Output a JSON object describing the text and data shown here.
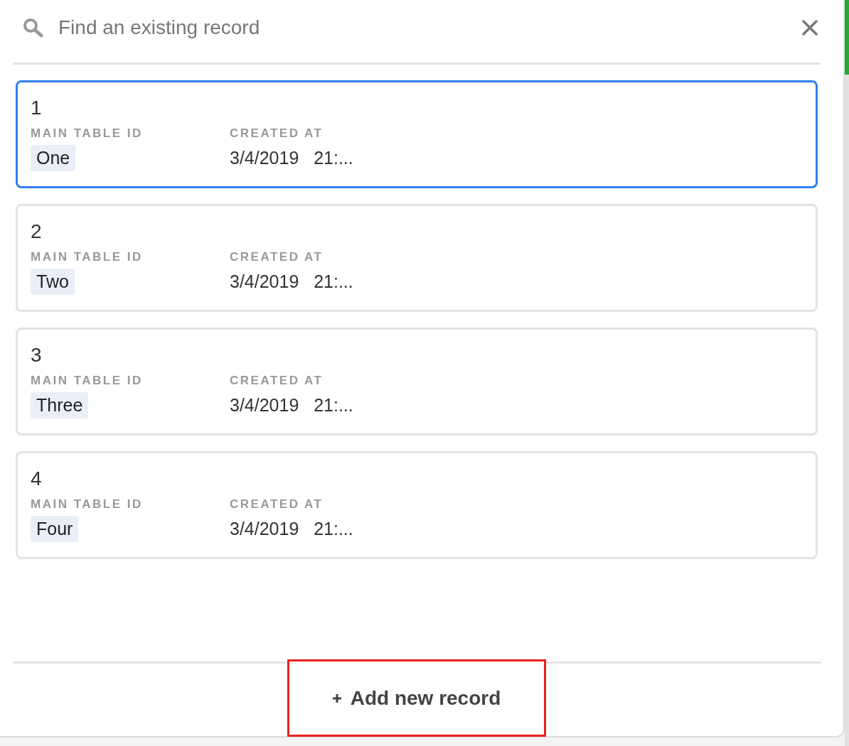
{
  "search": {
    "placeholder": "Find an existing record"
  },
  "records": [
    {
      "title": "1",
      "selected": true,
      "fields": [
        {
          "kind": "tag",
          "label": "MAIN TABLE ID",
          "value": "One"
        },
        {
          "kind": "text",
          "label": "CREATED AT",
          "value": "3/4/2019   21:..."
        }
      ]
    },
    {
      "title": "2",
      "selected": false,
      "fields": [
        {
          "kind": "tag",
          "label": "MAIN TABLE ID",
          "value": "Two"
        },
        {
          "kind": "text",
          "label": "CREATED AT",
          "value": "3/4/2019   21:..."
        }
      ]
    },
    {
      "title": "3",
      "selected": false,
      "fields": [
        {
          "kind": "tag",
          "label": "MAIN TABLE ID",
          "value": "Three"
        },
        {
          "kind": "text",
          "label": "CREATED AT",
          "value": "3/4/2019   21:..."
        }
      ]
    },
    {
      "title": "4",
      "selected": false,
      "fields": [
        {
          "kind": "tag",
          "label": "MAIN TABLE ID",
          "value": "Four"
        },
        {
          "kind": "text",
          "label": "CREATED AT",
          "value": "3/4/2019   21:..."
        }
      ]
    }
  ],
  "footer": {
    "button": "Add new record",
    "highlighted": true
  }
}
